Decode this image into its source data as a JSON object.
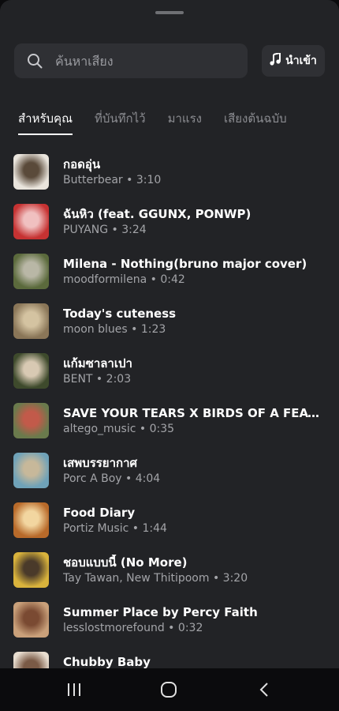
{
  "search": {
    "placeholder": "ค้นหาเสียง",
    "import_label": "นำเข้า"
  },
  "tabs": [
    "สำหรับคุณ",
    "ที่บันทึกไว้",
    "มาแรง",
    "เสียงต้นฉบับ"
  ],
  "tracks": [
    {
      "title": "กอดอุ่น",
      "artist": "Butterbear",
      "duration": "3:10",
      "colors": [
        "#e9e4dc",
        "#5a4a3a"
      ]
    },
    {
      "title": "ฉันหิว (feat. GGUNX, PONWP)",
      "artist": "PUYANG",
      "duration": "3:24",
      "colors": [
        "#c63232",
        "#f0c0c0"
      ]
    },
    {
      "title": "Milena - Nothing(bruno major cover)",
      "artist": "moodformilena",
      "duration": "0:42",
      "colors": [
        "#5b6a3c",
        "#b9b7a6"
      ]
    },
    {
      "title": "Today's cuteness",
      "artist": "moon blues",
      "duration": "1:23",
      "colors": [
        "#8a7658",
        "#d4c3a1"
      ]
    },
    {
      "title": "แก้มซาลาเปา",
      "artist": "BENT",
      "duration": "2:03",
      "colors": [
        "#3e4a2c",
        "#d8c9b3"
      ]
    },
    {
      "title": "SAVE YOUR TEARS X BIRDS OF A FEATHER (...",
      "artist": "altego_music",
      "duration": "0:35",
      "colors": [
        "#6a7a4c",
        "#c25a4a"
      ]
    },
    {
      "title": "เสพบรรยากาศ",
      "artist": "Porc A Boy",
      "duration": "4:04",
      "colors": [
        "#6fa2b8",
        "#c7b89a"
      ]
    },
    {
      "title": "Food Diary",
      "artist": "Portiz Music",
      "duration": "1:44",
      "colors": [
        "#b86a2a",
        "#f2d6a0"
      ]
    },
    {
      "title": "ชอบแบบนี้ (No More)",
      "artist": "Tay Tawan, New Thitipoom",
      "duration": "3:20",
      "colors": [
        "#d9b33c",
        "#4a3a2a"
      ]
    },
    {
      "title": "Summer Place by Percy Faith",
      "artist": "lesslostmorefound",
      "duration": "0:32",
      "colors": [
        "#c9a07a",
        "#7a4a32"
      ]
    },
    {
      "title": "Chubby Baby",
      "artist": "",
      "duration": "",
      "colors": [
        "#e8ddd0",
        "#7a5a46"
      ]
    }
  ]
}
